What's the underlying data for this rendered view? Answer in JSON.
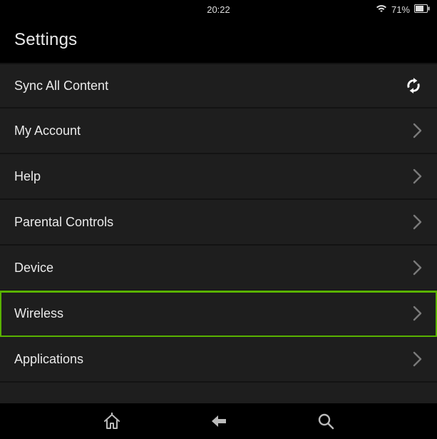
{
  "statusbar": {
    "time": "20:22",
    "battery_pct": "71%"
  },
  "header": {
    "title": "Settings"
  },
  "rows": [
    {
      "label": "Sync All Content",
      "action": "sync"
    },
    {
      "label": "My Account",
      "action": "nav"
    },
    {
      "label": "Help",
      "action": "nav"
    },
    {
      "label": "Parental Controls",
      "action": "nav"
    },
    {
      "label": "Device",
      "action": "nav"
    },
    {
      "label": "Wireless",
      "action": "nav",
      "highlighted": true
    },
    {
      "label": "Applications",
      "action": "nav"
    }
  ],
  "icons": {
    "wifi": "wifi-icon",
    "battery": "battery-icon",
    "chevron": "chevron-right-icon",
    "sync": "sync-icon",
    "home": "home-icon",
    "back": "back-icon",
    "search": "search-icon"
  }
}
